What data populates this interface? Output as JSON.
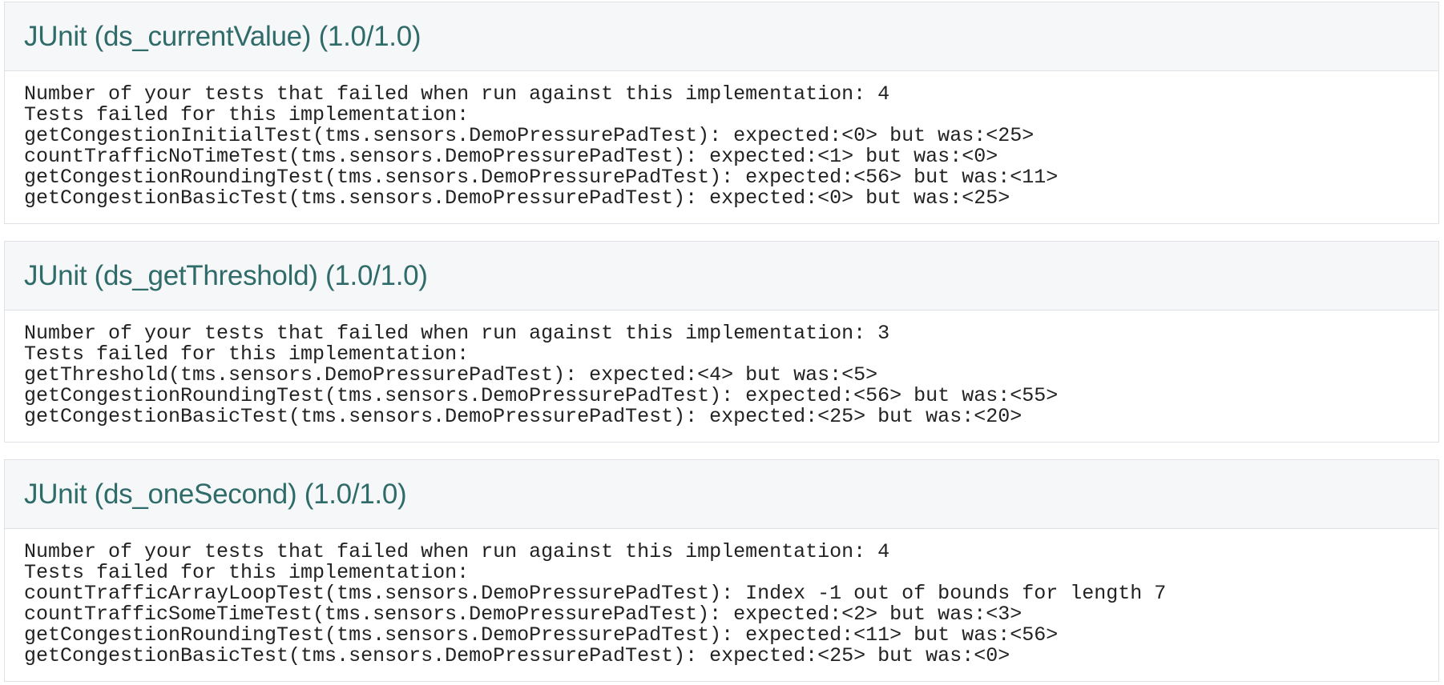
{
  "panels": [
    {
      "title": "JUnit (ds_currentValue) (1.0/1.0)",
      "lines": [
        "Number of your tests that failed when run against this implementation: 4",
        "Tests failed for this implementation:",
        "getCongestionInitialTest(tms.sensors.DemoPressurePadTest): expected:<0> but was:<25>",
        "countTrafficNoTimeTest(tms.sensors.DemoPressurePadTest): expected:<1> but was:<0>",
        "getCongestionRoundingTest(tms.sensors.DemoPressurePadTest): expected:<56> but was:<11>",
        "getCongestionBasicTest(tms.sensors.DemoPressurePadTest): expected:<0> but was:<25>"
      ]
    },
    {
      "title": "JUnit (ds_getThreshold) (1.0/1.0)",
      "lines": [
        "Number of your tests that failed when run against this implementation: 3",
        "Tests failed for this implementation:",
        "getThreshold(tms.sensors.DemoPressurePadTest): expected:<4> but was:<5>",
        "getCongestionRoundingTest(tms.sensors.DemoPressurePadTest): expected:<56> but was:<55>",
        "getCongestionBasicTest(tms.sensors.DemoPressurePadTest): expected:<25> but was:<20>"
      ]
    },
    {
      "title": "JUnit (ds_oneSecond) (1.0/1.0)",
      "lines": [
        "Number of your tests that failed when run against this implementation: 4",
        "Tests failed for this implementation:",
        "countTrafficArrayLoopTest(tms.sensors.DemoPressurePadTest): Index -1 out of bounds for length 7",
        "countTrafficSomeTimeTest(tms.sensors.DemoPressurePadTest): expected:<2> but was:<3>",
        "getCongestionRoundingTest(tms.sensors.DemoPressurePadTest): expected:<11> but was:<56>",
        "getCongestionBasicTest(tms.sensors.DemoPressurePadTest): expected:<25> but was:<0>"
      ]
    }
  ]
}
